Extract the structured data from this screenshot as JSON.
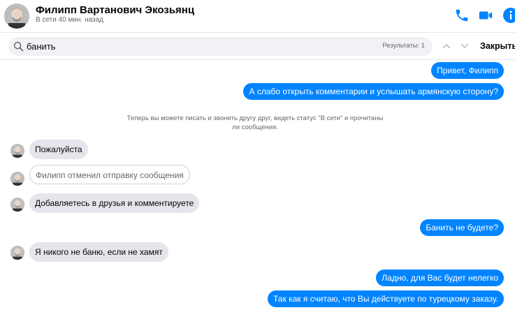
{
  "header": {
    "name": "Филипп Вартанович Экозьянц",
    "status": "В сети 40 мин. назад",
    "colors": {
      "accent": "#0084ff"
    }
  },
  "search": {
    "query": "банить",
    "results_label": "Результаты: 1",
    "close_label": "Закрыть"
  },
  "messages": {
    "m1": "Привет, Филипп",
    "m2": "А слабо открыть комментарии и услышать армянскую сторону?",
    "system": "Теперь вы можете писать и звонить другу друг, видеть статус \"В сети\" и прочитаны ли сообщения.",
    "m3": "Пожалуйста",
    "m4": "Филипп отменил отправку сообщения",
    "m5": "Добавляетесь в друзья и комментируете",
    "m6": "Банить не будете?",
    "m7": "Я никого не баню, если не хамят",
    "m8": "Ладно, для Вас будет нелегко",
    "m9": "Так как я считаю, что Вы действуете по турецкому заказу."
  }
}
